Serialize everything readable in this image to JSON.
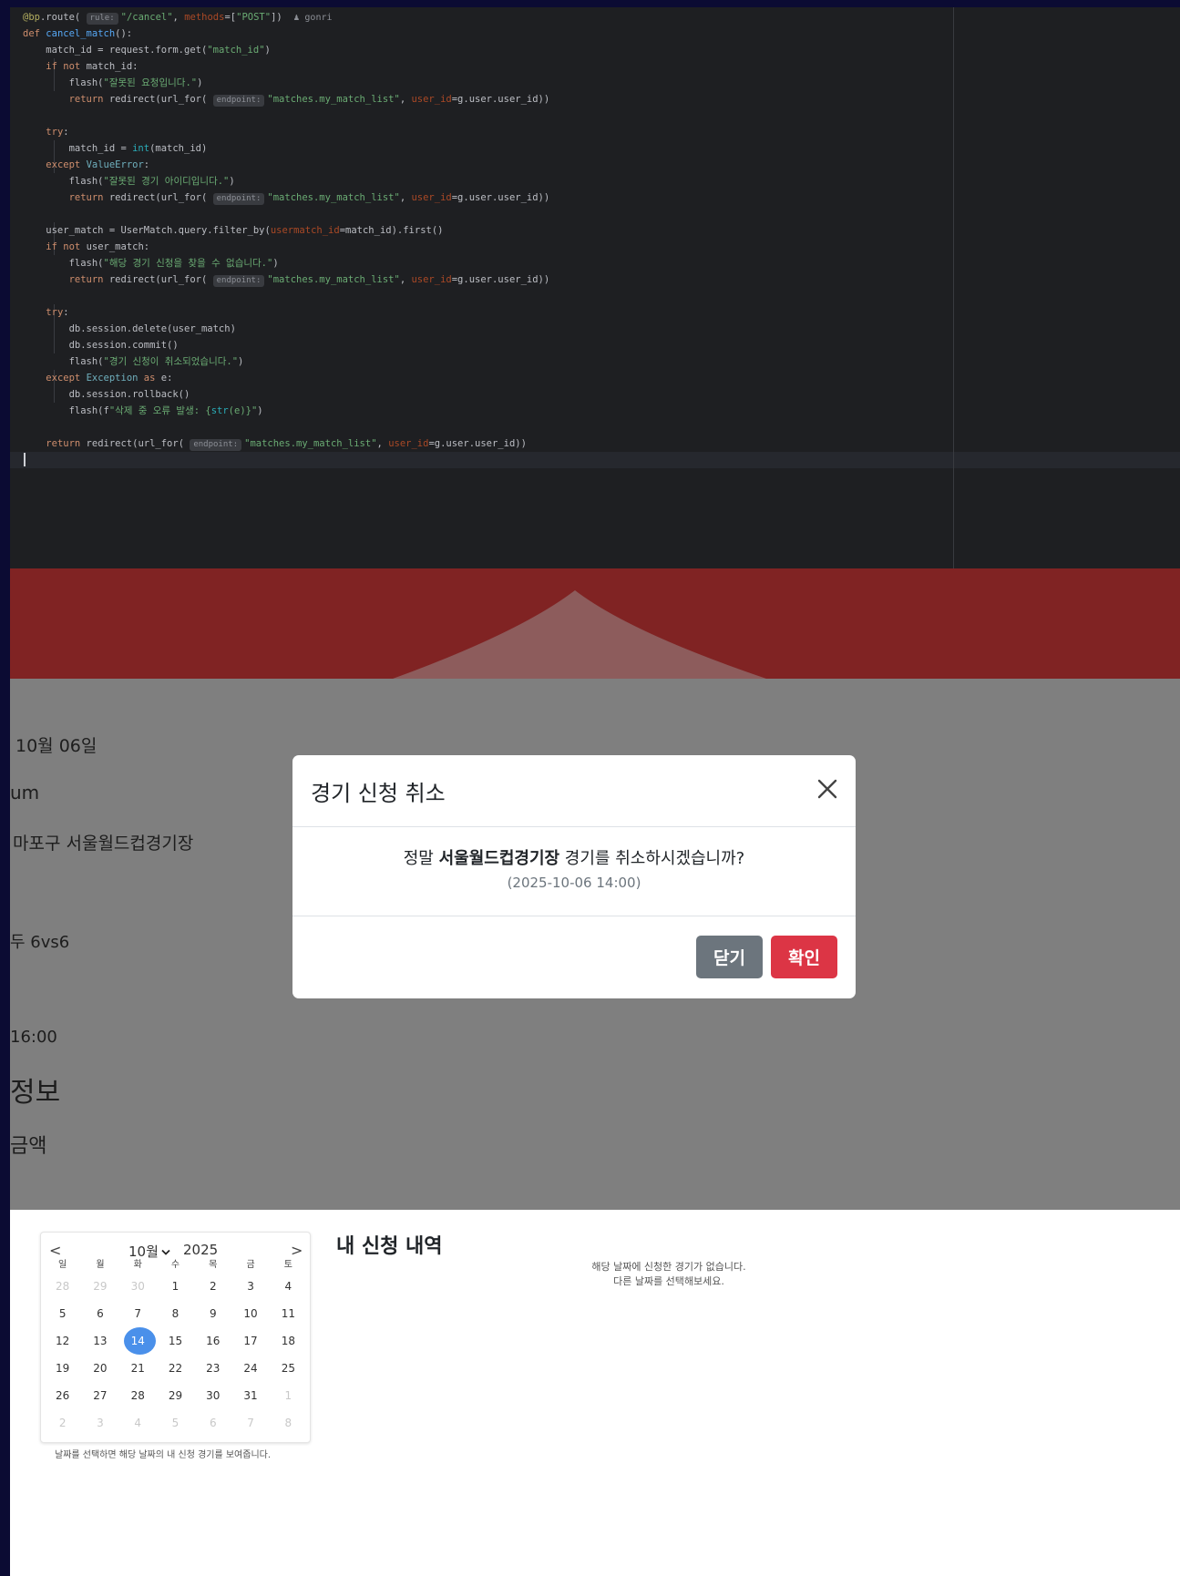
{
  "editor": {
    "code_lines": [
      "@bp.route( rule: \"/cancel\", methods=[\"POST\"])  ♟ gonri",
      "def cancel_match():",
      "    match_id = request.form.get(\"match_id\")",
      "    if not match_id:",
      "        flash(\"잘못된 요청입니다.\")",
      "        return redirect(url_for( endpoint: \"matches.my_match_list\", user_id=g.user.user_id))",
      "",
      "    try:",
      "        match_id = int(match_id)",
      "    except ValueError:",
      "        flash(\"잘못된 경기 아이디입니다.\")",
      "        return redirect(url_for( endpoint: \"matches.my_match_list\", user_id=g.user.user_id))",
      "",
      "    user_match = UserMatch.query.filter_by(usermatch_id=match_id).first()",
      "    if not user_match:",
      "        flash(\"해당 경기 신청을 찾을 수 없습니다.\")",
      "        return redirect(url_for( endpoint: \"matches.my_match_list\", user_id=g.user.user_id))",
      "",
      "    try:",
      "        db.session.delete(user_match)",
      "        db.session.commit()",
      "        flash(\"경기 신청이 취소되었습니다.\")",
      "    except Exception as e:",
      "        db.session.rollback()",
      "        flash(f\"삭제 중 오류 발생: {str(e)}\")",
      "",
      "    return redirect(url_for( endpoint: \"matches.my_match_list\", user_id=g.user.user_id))"
    ]
  },
  "background_page": {
    "date": "10월 06일",
    "stadium_partial": "um",
    "address_partial": "마포구 서울월드컵경기장",
    "format_partial": "두 6vs6",
    "time_partial": "16:00",
    "section_partial": "정보",
    "amount_partial": "금액"
  },
  "modal": {
    "title": "경기 신청 취소",
    "message_prefix": "정말 ",
    "stadium_name": "서울월드컵경기장",
    "message_suffix": " 경기를 취소하시겠습니까?",
    "datetime": "(2025-10-06 14:00)",
    "close_label": "닫기",
    "confirm_label": "확인"
  },
  "calendar": {
    "prev": "<",
    "next": ">",
    "month_label": "10월",
    "year_label": "2025",
    "weekdays": [
      "일",
      "월",
      "화",
      "수",
      "목",
      "금",
      "토"
    ],
    "weeks": [
      [
        "28",
        "29",
        "30",
        "1",
        "2",
        "3",
        "4"
      ],
      [
        "5",
        "6",
        "7",
        "8",
        "9",
        "10",
        "11"
      ],
      [
        "12",
        "13",
        "14",
        "15",
        "16",
        "17",
        "18"
      ],
      [
        "19",
        "20",
        "21",
        "22",
        "23",
        "24",
        "25"
      ],
      [
        "26",
        "27",
        "28",
        "29",
        "30",
        "31",
        "1"
      ],
      [
        "2",
        "3",
        "4",
        "5",
        "6",
        "7",
        "8"
      ]
    ],
    "selected_day": "14",
    "hint": "날짜를 선택하면 해당 날짜의 내 신청 경기를 보여줍니다."
  },
  "my_applications": {
    "title": "내 신청 내역",
    "empty_line1": "해당 날짜에 신청한 경기가 없습니다.",
    "empty_line2": "다른 날짜를 선택해보세요."
  },
  "colors": {
    "hero_red": "#802323",
    "confirm_red": "#dc3545",
    "close_gray": "#6c757d",
    "selected_blue": "#4a90ea"
  }
}
